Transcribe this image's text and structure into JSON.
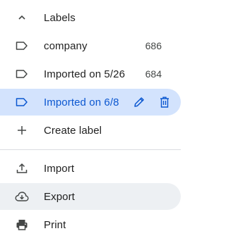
{
  "labels_section": {
    "header": "Labels",
    "items": [
      {
        "name": "company",
        "count": "686"
      },
      {
        "name": "Imported on 5/26",
        "count": "684"
      },
      {
        "name": "Imported on 6/8",
        "count": ""
      }
    ],
    "create_label": "Create label"
  },
  "actions": {
    "import": "Import",
    "export": "Export",
    "print": "Print"
  },
  "colors": {
    "selected_bg": "#d3e3fd",
    "selected_text": "#0b57d0",
    "hover_bg": "#edf0f3"
  },
  "icons": {
    "header": "chevron-up-icon",
    "label": "label-tag-icon",
    "create": "plus-icon",
    "edit": "pencil-icon",
    "delete": "trash-icon",
    "import": "upload-icon",
    "export": "cloud-download-icon",
    "print": "printer-icon"
  }
}
